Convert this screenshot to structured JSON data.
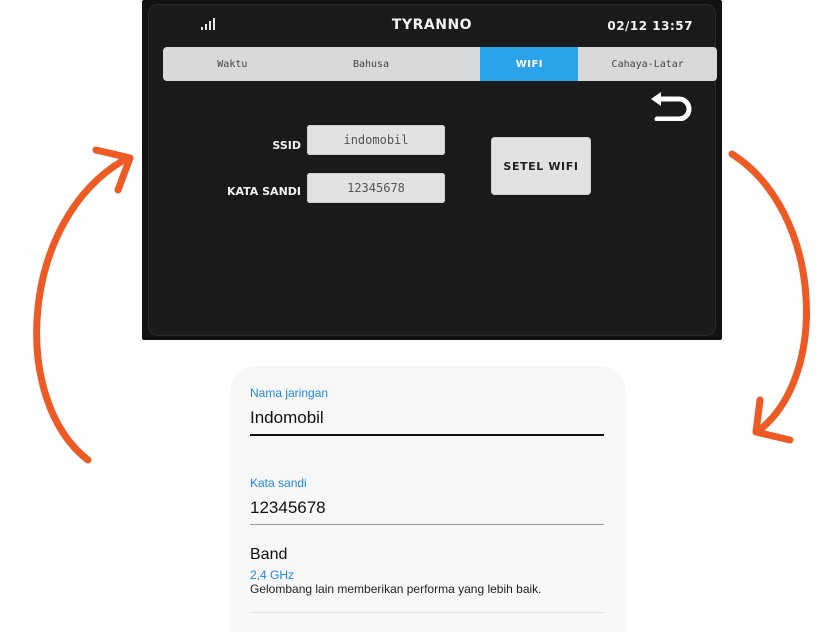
{
  "device": {
    "title": "TYRANNO",
    "datetime": "02/12 13:57",
    "icons": {
      "signal": "signal-bars-icon",
      "back": "back-arrow-icon"
    },
    "tabs": [
      {
        "label": "Waktu",
        "active": false
      },
      {
        "label": "Bahusa",
        "active": false
      },
      {
        "label": "WIFI",
        "active": true
      },
      {
        "label": "Cahaya-Latar",
        "active": false
      }
    ],
    "ssid": {
      "label": "SSID",
      "value": "indomobil"
    },
    "password": {
      "label": "KATA SANDI",
      "value": "12345678"
    },
    "setel_button": "SETEL WIFI",
    "accent_color": "#2aa3ea"
  },
  "phone": {
    "network_label": "Nama jaringan",
    "network_value": "Indomobil",
    "password_label": "Kata sandi",
    "password_value": "12345678",
    "band_title": "Band",
    "band_value": "2,4 GHz",
    "band_note": "Gelombang lain memberikan performa yang lebih baik.",
    "label_color": "#1e88e5"
  },
  "arrows": {
    "color": "#ee5a24",
    "icon": "sync-arrows-icon"
  }
}
